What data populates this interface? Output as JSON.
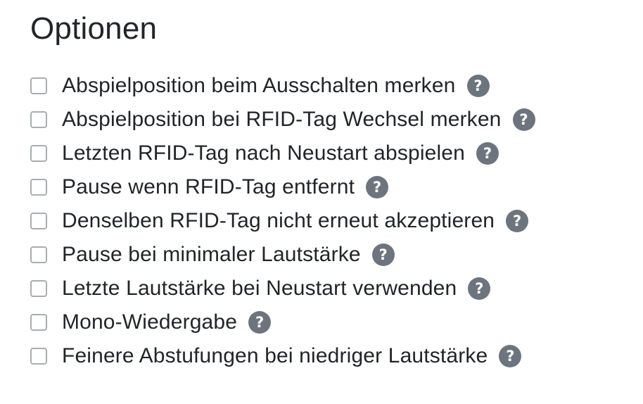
{
  "section": {
    "title": "Optionen"
  },
  "options": [
    {
      "label": "Abspielposition beim Ausschalten merken",
      "checked": false,
      "help_icon": "?"
    },
    {
      "label": "Abspielposition bei RFID-Tag Wechsel merken",
      "checked": false,
      "help_icon": "?"
    },
    {
      "label": "Letzten RFID-Tag nach Neustart abspielen",
      "checked": false,
      "help_icon": "?"
    },
    {
      "label": "Pause wenn RFID-Tag entfernt",
      "checked": false,
      "help_icon": "?"
    },
    {
      "label": "Denselben RFID-Tag nicht erneut akzeptieren",
      "checked": false,
      "help_icon": "?"
    },
    {
      "label": "Pause bei minimaler Lautstärke",
      "checked": false,
      "help_icon": "?"
    },
    {
      "label": "Letzte Lautstärke bei Neustart verwenden",
      "checked": false,
      "help_icon": "?"
    },
    {
      "label": "Mono-Wiedergabe",
      "checked": false,
      "help_icon": "?"
    },
    {
      "label": "Feinere Abstufungen bei niedriger Lautstärke",
      "checked": false,
      "help_icon": "?"
    }
  ],
  "colors": {
    "text": "#212529",
    "checkbox_border": "#a9adb2",
    "help_icon_bg": "#6c757d",
    "help_icon_fg": "#ffffff"
  }
}
